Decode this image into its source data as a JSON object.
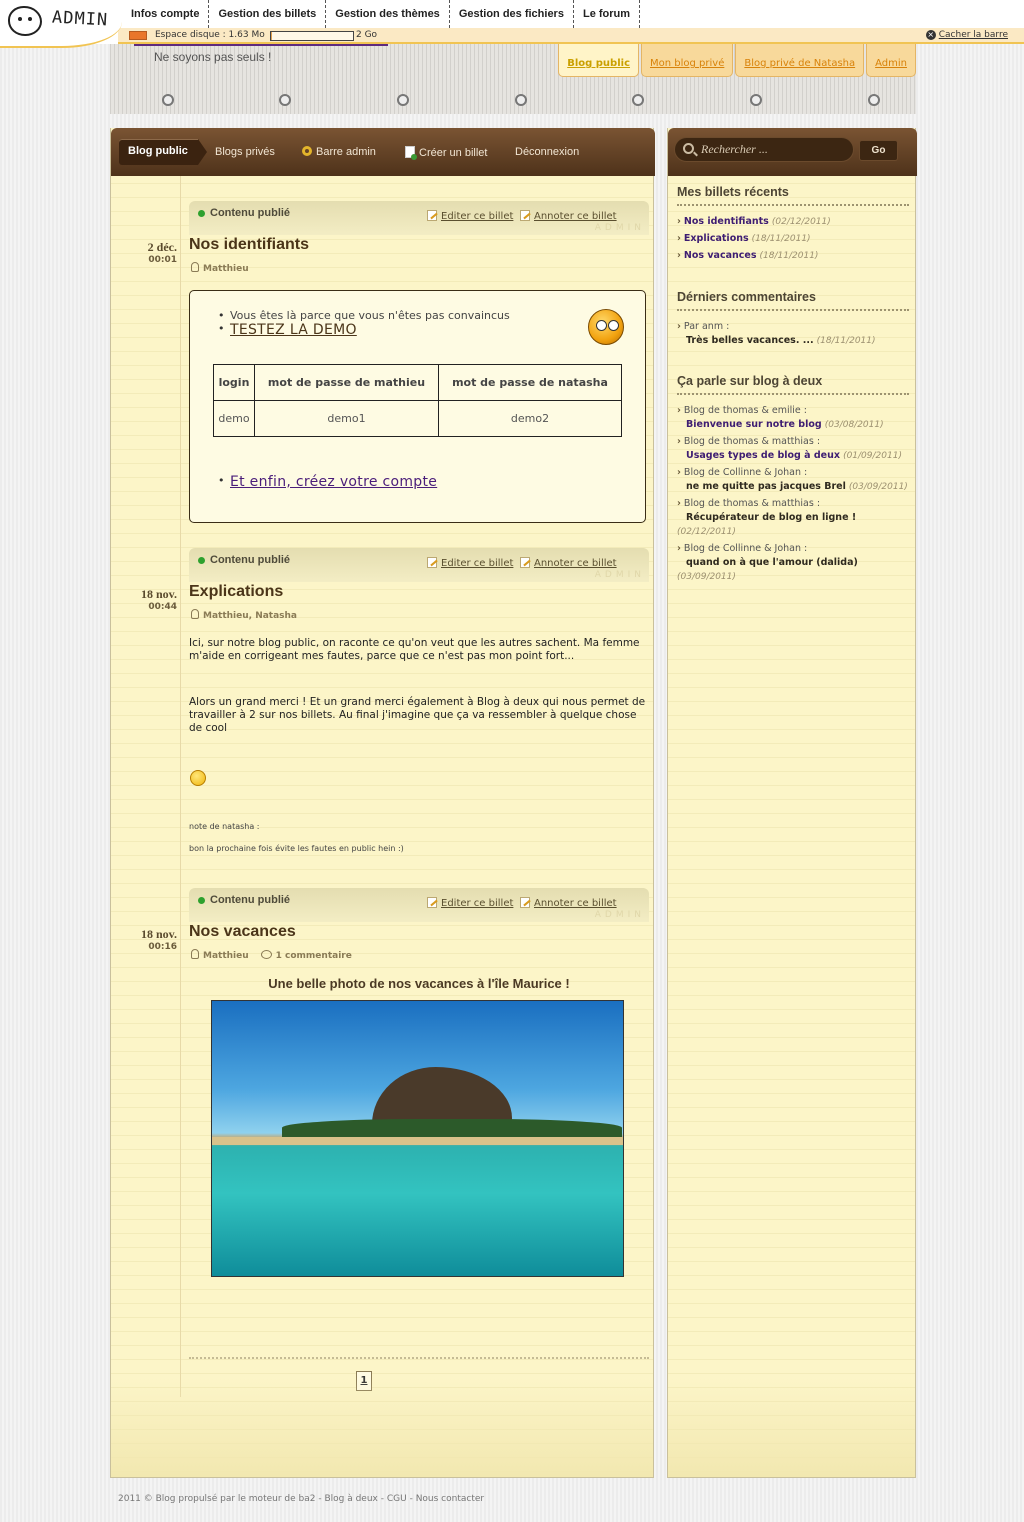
{
  "admin_bar": {
    "logo_text": "ADMIN",
    "nav": [
      "Infos compte",
      "Gestion des billets",
      "Gestion des thèmes",
      "Gestion des fichiers",
      "Le forum"
    ],
    "disk_label": "Espace disque : 1.63 Mo",
    "disk_max": "2 Go",
    "disk_usage_fraction": 0.001,
    "hide_bar": "Cacher la barre"
  },
  "header": {
    "slogan": "Ne soyons pas seuls !",
    "blog_tabs": [
      {
        "label": "Blog public",
        "active": true
      },
      {
        "label": "Mon blog privé",
        "active": false
      },
      {
        "label": "Blog privé de Natasha",
        "active": false
      },
      {
        "label": "Admin",
        "active": false
      }
    ]
  },
  "main_nav": {
    "items": [
      "Blog public",
      "Blogs privés",
      "Barre admin",
      "Créer un billet",
      "Déconnexion"
    ],
    "active": "Blog public"
  },
  "post_common": {
    "status": "Contenu publié",
    "edit_label": "Editer ce billet",
    "annotate_label": "Annoter ce billet",
    "watermark": "ADMIN"
  },
  "posts": [
    {
      "date": "2 déc.",
      "time": "00:01",
      "title": "Nos identifiants",
      "author": "Matthieu",
      "bullet_text": "Vous êtes là parce que vous n'êtes pas convaincus",
      "demo_link": "TESTEZ LA DEMO",
      "table": {
        "headers": [
          "login",
          "mot de passe de mathieu",
          "mot de passe de natasha"
        ],
        "rows": [
          [
            "demo",
            "demo1",
            "demo2"
          ]
        ]
      },
      "bottom_link": "Et enfin, créez votre compte"
    },
    {
      "date": "18 nov.",
      "time": "00:44",
      "title": "Explications",
      "author": "Matthieu, Natasha",
      "paragraph1": "Ici, sur notre blog public, on raconte ce qu'on veut que les autres sachent. Ma femme m'aide en corrigeant mes fautes, parce que ce n'est pas mon point fort...",
      "paragraph2": "Alors un grand merci ! Et un grand merci également à Blog à deux qui nous permet de travailler à 2 sur nos billets. Au final j'imagine que ça va ressembler à quelque chose de cool",
      "note_label": "note de natasha :",
      "note_text": "bon la prochaine fois évite les fautes en public hein :)"
    },
    {
      "date": "18 nov.",
      "time": "00:16",
      "title": "Nos vacances",
      "author": "Matthieu",
      "comments": "1 commentaire",
      "caption": "Une belle photo de nos vacances à l'île Maurice !"
    }
  ],
  "pagination": {
    "current": "1"
  },
  "sidebar": {
    "search_placeholder": "Rechercher ...",
    "search_button": "Go",
    "recent_title": "Mes billets récents",
    "recent": [
      {
        "title": "Nos identifiants",
        "date": "(02/12/2011)"
      },
      {
        "title": "Explications",
        "date": "(18/11/2011)"
      },
      {
        "title": "Nos vacances",
        "date": "(18/11/2011)"
      }
    ],
    "comments_title": "Dérniers commentaires",
    "comment_by": "Par anm :",
    "comment_text": "Très belles vacances. ...",
    "comment_date": "(18/11/2011)",
    "buzz_title": "Ça parle sur blog à deux",
    "buzz": [
      {
        "source": "Blog de thomas & emilie :",
        "title": "Bienvenue sur notre blog",
        "date": "(03/08/2011)"
      },
      {
        "source": "Blog de thomas & matthias :",
        "title": "Usages types de blog à deux",
        "date": "(01/09/2011)"
      },
      {
        "source": "Blog de Collinne & Johan :",
        "title": "ne me quitte pas jacques Brel",
        "date": "(03/09/2011)"
      },
      {
        "source": "Blog de thomas & matthias :",
        "title": "Récupérateur de blog en ligne !",
        "date": "(02/12/2011)"
      },
      {
        "source": "Blog de Collinne & Johan :",
        "title": "quand on à que l'amour (dalida)",
        "date": "(03/09/2011)"
      }
    ]
  },
  "footer": {
    "prefix": "2011 © Blog propulsé par le moteur de ba2 - ",
    "link1": "Blog à deux",
    "sep1": " - ",
    "link2": "CGU",
    "sep2": " - ",
    "link3": "Nous contacter"
  }
}
